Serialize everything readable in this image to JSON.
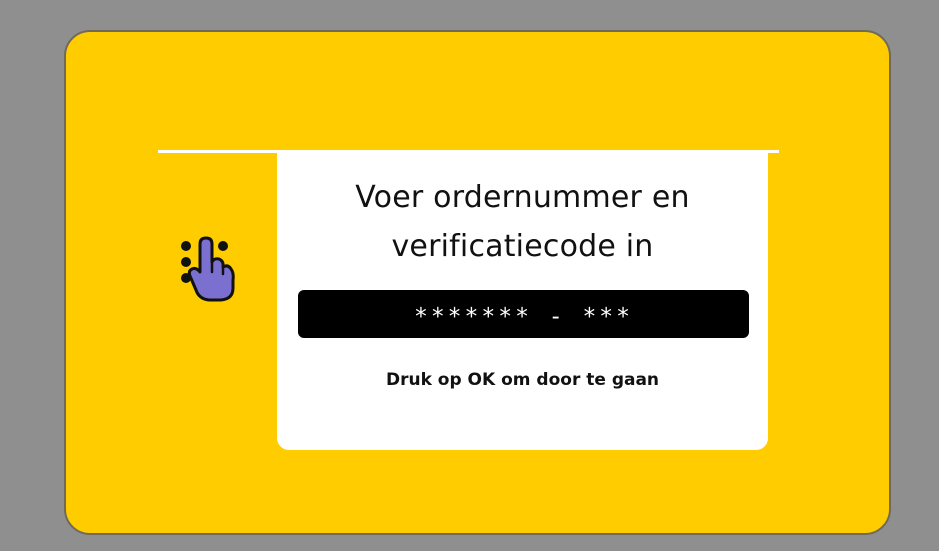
{
  "dialog": {
    "title_line1": "Voer ordernummer en",
    "title_line2": "verificatiecode in",
    "code_value": "******* - ***",
    "hint": "Druk op OK om door te gaan",
    "icon": "touch-hand-icon"
  },
  "colors": {
    "background": "#8f8f8f",
    "panel": "#ffcc00",
    "card": "#ffffff",
    "field": "#000000",
    "icon_hand": "#7b6fd0"
  }
}
